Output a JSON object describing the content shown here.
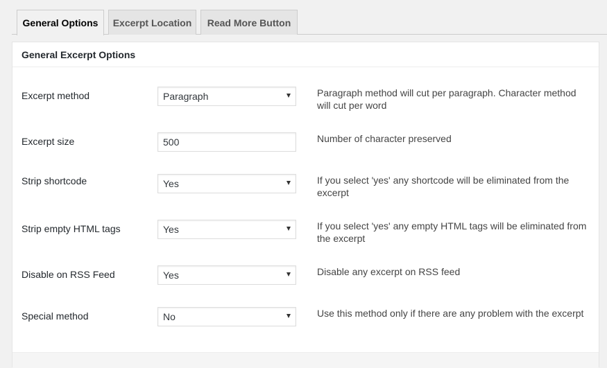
{
  "tabs": [
    {
      "label": "General Options",
      "active": true
    },
    {
      "label": "Excerpt Location",
      "active": false
    },
    {
      "label": "Read More Button",
      "active": false
    }
  ],
  "panel": {
    "title": "General Excerpt Options",
    "rows": [
      {
        "label": "Excerpt method",
        "type": "select",
        "value": "Paragraph",
        "description": "Paragraph method will cut per paragraph. Character method will cut per word"
      },
      {
        "label": "Excerpt size",
        "type": "input",
        "value": "500",
        "description": "Number of character preserved"
      },
      {
        "label": "Strip shortcode",
        "type": "select",
        "value": "Yes",
        "description": "If you select 'yes' any shortcode will be eliminated from the excerpt"
      },
      {
        "label": "Strip empty HTML tags",
        "type": "select",
        "value": "Yes",
        "description": "If you select 'yes' any empty HTML tags will be eliminated from the excerpt"
      },
      {
        "label": "Disable on RSS Feed",
        "type": "select",
        "value": "Yes",
        "description": "Disable any excerpt on RSS feed"
      },
      {
        "label": "Special method",
        "type": "select",
        "value": "No",
        "description": "Use this method only if there are any problem with the excerpt"
      }
    ]
  }
}
